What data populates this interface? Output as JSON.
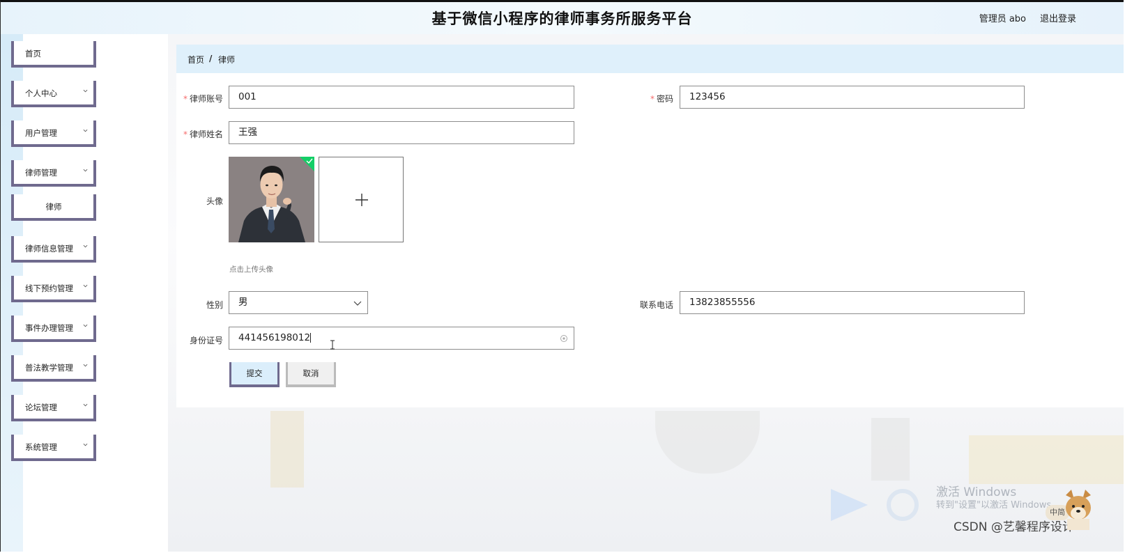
{
  "header": {
    "title": "基于微信小程序的律师事务所服务平台",
    "user_label": "管理员 abo",
    "logout_label": "退出登录"
  },
  "sidebar": {
    "items": [
      {
        "label": "首页",
        "has_arrow": false
      },
      {
        "label": "个人中心",
        "has_arrow": true
      },
      {
        "label": "用户管理",
        "has_arrow": true
      },
      {
        "label": "律师管理",
        "has_arrow": true
      },
      {
        "label": "律师",
        "has_arrow": false,
        "submenu": true
      },
      {
        "label": "律师信息管理",
        "has_arrow": true
      },
      {
        "label": "线下预约管理",
        "has_arrow": true
      },
      {
        "label": "事件办理管理",
        "has_arrow": true
      },
      {
        "label": "普法教学管理",
        "has_arrow": true
      },
      {
        "label": "论坛管理",
        "has_arrow": true
      },
      {
        "label": "系统管理",
        "has_arrow": true
      }
    ]
  },
  "breadcrumb": {
    "home": "首页",
    "separator": "/",
    "current": "律师"
  },
  "form": {
    "account": {
      "label": "律师账号",
      "value": "001",
      "required": true
    },
    "password": {
      "label": "密码",
      "value": "123456",
      "required": true
    },
    "name": {
      "label": "律师姓名",
      "value": "王强",
      "required": true
    },
    "avatar": {
      "label": "头像",
      "tip": "点击上传头像",
      "add_symbol": "+"
    },
    "gender": {
      "label": "性别",
      "value": "男"
    },
    "phone": {
      "label": "联系电话",
      "value": "13823855556"
    },
    "id_number": {
      "label": "身份证号",
      "value": "441456198012"
    },
    "submit_label": "提交",
    "cancel_label": "取消"
  },
  "overlay": {
    "windows_line1": "激活 Windows",
    "windows_line2": "转到\"设置\"以激活 Windows。",
    "csdn": "CSDN @艺馨程序设计",
    "ime_badge": "中简"
  },
  "colors": {
    "accent_border": "#6f6a8e",
    "breadcrumb_bg": "#dff0fb",
    "required": "#f56c6c",
    "success": "#13ce66"
  }
}
